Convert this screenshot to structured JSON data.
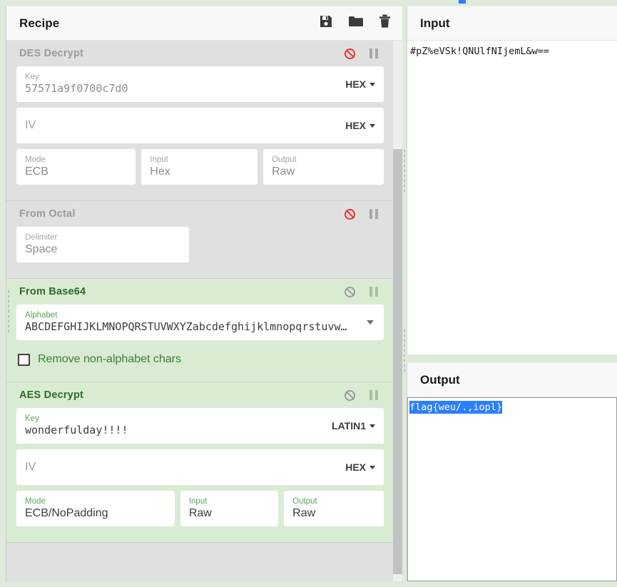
{
  "app": {
    "accent_green": "#d9ecd3",
    "accent_green_text": "#2d6a2d",
    "disabled_red": "#f0312f",
    "selection_blue": "#2a7fff"
  },
  "recipe": {
    "title": "Recipe",
    "actions": [
      {
        "name": "save-recipe",
        "label": "Save recipe",
        "icon": "save-icon"
      },
      {
        "name": "load-recipe",
        "label": "Load recipe",
        "icon": "folder-icon"
      },
      {
        "name": "clear-recipe",
        "label": "Clear recipe",
        "icon": "trash-icon"
      }
    ],
    "operations": [
      {
        "name": "des-decrypt",
        "title": "DES Decrypt",
        "state": "disabled",
        "disable_icon": "ban-icon",
        "breakpoint_icon": "pause-icon",
        "args": {
          "key_label": "Key",
          "key_value": "57571a9f0700c7d0",
          "key_encoding": "HEX",
          "iv_label": "IV",
          "iv_value": "",
          "iv_encoding": "HEX",
          "mode_label": "Mode",
          "mode_value": "ECB",
          "input_label": "Input",
          "input_value": "Hex",
          "output_label": "Output",
          "output_value": "Raw"
        }
      },
      {
        "name": "from-octal",
        "title": "From Octal",
        "state": "disabled",
        "disable_icon": "ban-icon",
        "breakpoint_icon": "pause-icon",
        "args": {
          "delimiter_label": "Delimiter",
          "delimiter_value": "Space"
        }
      },
      {
        "name": "from-base64",
        "title": "From Base64",
        "state": "enabled",
        "disable_icon": "ban-icon",
        "breakpoint_icon": "pause-icon",
        "args": {
          "alphabet_label": "Alphabet",
          "alphabet_value": "ABCDEFGHIJKLMNOPQRSTUVWXYZabcdefghijklmnopqrstuvw…",
          "remove_non_alphabet_label": "Remove non-alphabet chars",
          "remove_non_alphabet_checked": false
        }
      },
      {
        "name": "aes-decrypt",
        "title": "AES Decrypt",
        "state": "enabled",
        "disable_icon": "ban-icon",
        "breakpoint_icon": "pause-icon",
        "args": {
          "key_label": "Key",
          "key_value": "wonderfulday!!!!",
          "key_encoding": "LATIN1",
          "iv_label": "IV",
          "iv_value": "",
          "iv_encoding": "HEX",
          "mode_label": "Mode",
          "mode_value": "ECB/NoPadding",
          "input_label": "Input",
          "input_value": "Raw",
          "output_label": "Output",
          "output_value": "Raw"
        }
      }
    ]
  },
  "input": {
    "title": "Input",
    "value": "#pZ%eVSk!QNUlfNIjemL&w=="
  },
  "output": {
    "title": "Output",
    "value": "flag{weu/.,iopl}",
    "selected": true
  }
}
